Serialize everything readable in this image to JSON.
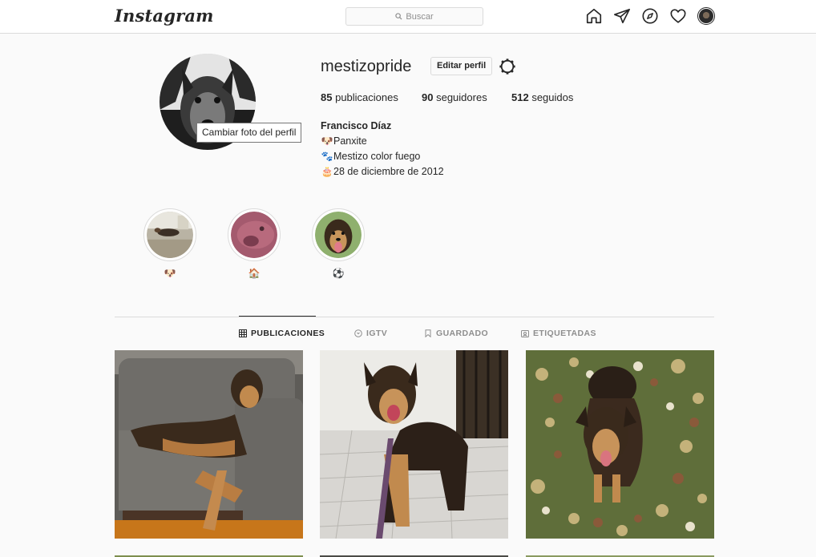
{
  "nav": {
    "logo": "Instagram",
    "search_placeholder": "Buscar",
    "icons": [
      "home-icon",
      "direct-icon",
      "explore-icon",
      "activity-heart-icon",
      "profile-avatar"
    ]
  },
  "profile": {
    "username": "mestizopride",
    "edit_label": "Editar perfil",
    "avatar_tooltip": "Cambiar foto del perfil",
    "stats": {
      "posts_count": "85",
      "posts_label": "publicaciones",
      "followers_count": "90",
      "followers_label": "seguidores",
      "following_count": "512",
      "following_label": "seguidos"
    },
    "bio": {
      "full_name": "Francisco Díaz",
      "line1_emoji": "🐶",
      "line1_text": "Panxite",
      "line2_emoji": "🐾",
      "line2_text": "Mestizo color fuego",
      "line3_emoji": "🎂",
      "line3_text": "28 de diciembre de 2012"
    }
  },
  "highlights": [
    {
      "label": "🐶"
    },
    {
      "label": "🏠"
    },
    {
      "label": "⚽"
    }
  ],
  "tabs": [
    {
      "label": "PUBLICACIONES",
      "active": true
    },
    {
      "label": "IGTV",
      "active": false
    },
    {
      "label": "GUARDADO",
      "active": false
    },
    {
      "label": "ETIQUETADAS",
      "active": false
    }
  ],
  "colors": {
    "background": "#fafafa",
    "border": "#dbdbdb",
    "text": "#262626",
    "muted": "#8e8e8e"
  }
}
